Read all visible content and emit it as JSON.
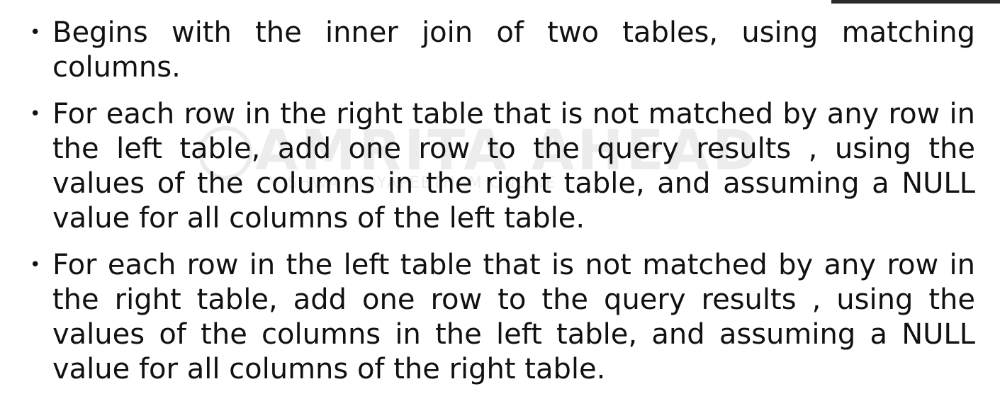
{
  "watermark": {
    "main": "AMRITA AHEAD",
    "sub": "VISHWA VIDYAPEETHAM ONLINE"
  },
  "bullets": [
    {
      "symbol": "•",
      "text": "Begins with the inner join of two tables, using matching columns."
    },
    {
      "symbol": "•",
      "text": "For each row in the right table that is not matched by any row in the left table, add one row to the query results , using the values of the columns in the right table, and assuming a NULL value for all columns of the left table."
    },
    {
      "symbol": "•",
      "text": "For each row in the left table that is not matched by any row in the right table, add one row to the query results , using the values of the columns in the left table, and assuming a NULL value for all columns of the right table."
    }
  ]
}
